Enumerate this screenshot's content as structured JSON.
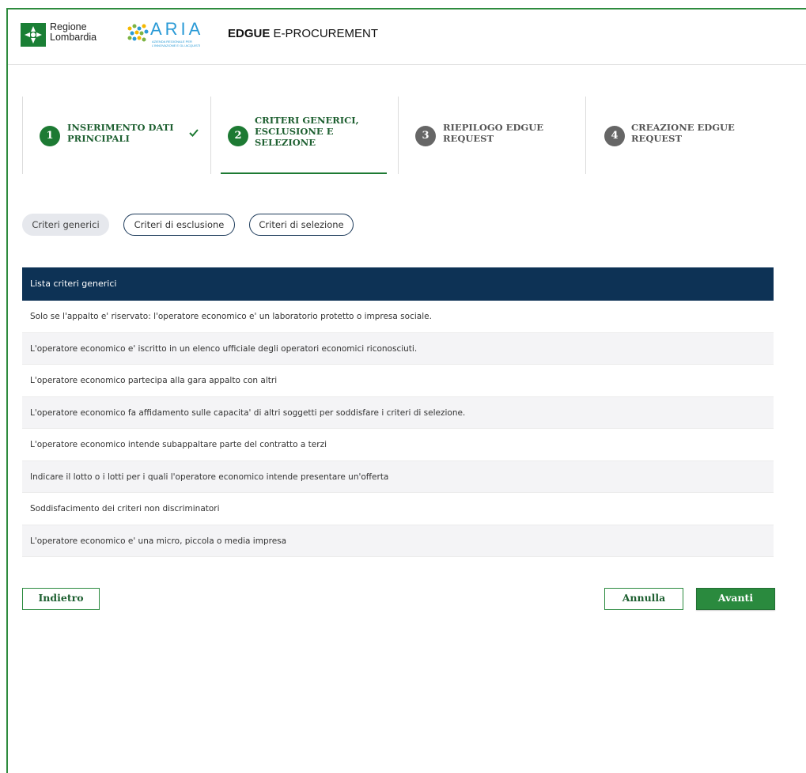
{
  "header": {
    "rl_logo_line1": "Regione",
    "rl_logo_line2": "Lombardia",
    "aria_logo": "ARIA",
    "aria_sub": "AZIENDA REGIONALE PER L'INNOVAZIONE E GLI ACQUISTI",
    "app_title_bold": "EDGUE",
    "app_title_rest": " E-PROCUREMENT",
    "brand_color": "#1d7a33"
  },
  "stepper": {
    "steps": [
      {
        "number": "1",
        "label_line1": "INSERIMENTO DATI",
        "label_line2": "PRINCIPALI",
        "label_line3": "",
        "state": "completed"
      },
      {
        "number": "2",
        "label_line1": "CRITERI GENERICI,",
        "label_line2": "ESCLUSIONE E",
        "label_line3": "SELEZIONE",
        "state": "active"
      },
      {
        "number": "3",
        "label_line1": "RIEPILOGO EDGUE",
        "label_line2": "REQUEST",
        "label_line3": "",
        "state": "pending"
      },
      {
        "number": "4",
        "label_line1": "CREAZIONE EDGUE",
        "label_line2": "REQUEST",
        "label_line3": "",
        "state": "pending"
      }
    ],
    "check_icon": "check-icon"
  },
  "tabs": [
    {
      "label": "Criteri generici",
      "active": true
    },
    {
      "label": "Criteri di esclusione",
      "active": false
    },
    {
      "label": "Criteri di selezione",
      "active": false
    }
  ],
  "table": {
    "header": "Lista criteri generici",
    "rows": [
      "Solo se l'appalto e' riservato: l'operatore economico e' un laboratorio protetto o impresa sociale.",
      "L'operatore economico e' iscritto in un elenco ufficiale degli operatori economici riconosciuti.",
      "L'operatore economico partecipa alla gara appalto con altri",
      "L'operatore economico fa affidamento sulle capacita' di altri soggetti per soddisfare i criteri di selezione.",
      "L'operatore economico intende subappaltare parte del contratto a terzi",
      "Indicare il lotto o i lotti per i quali l'operatore economico intende presentare un'offerta",
      "Soddisfacimento dei criteri non discriminatori",
      "L'operatore economico e' una micro, piccola o media impresa"
    ]
  },
  "buttons": {
    "back": "Indietro",
    "cancel": "Annulla",
    "next": "Avanti"
  }
}
